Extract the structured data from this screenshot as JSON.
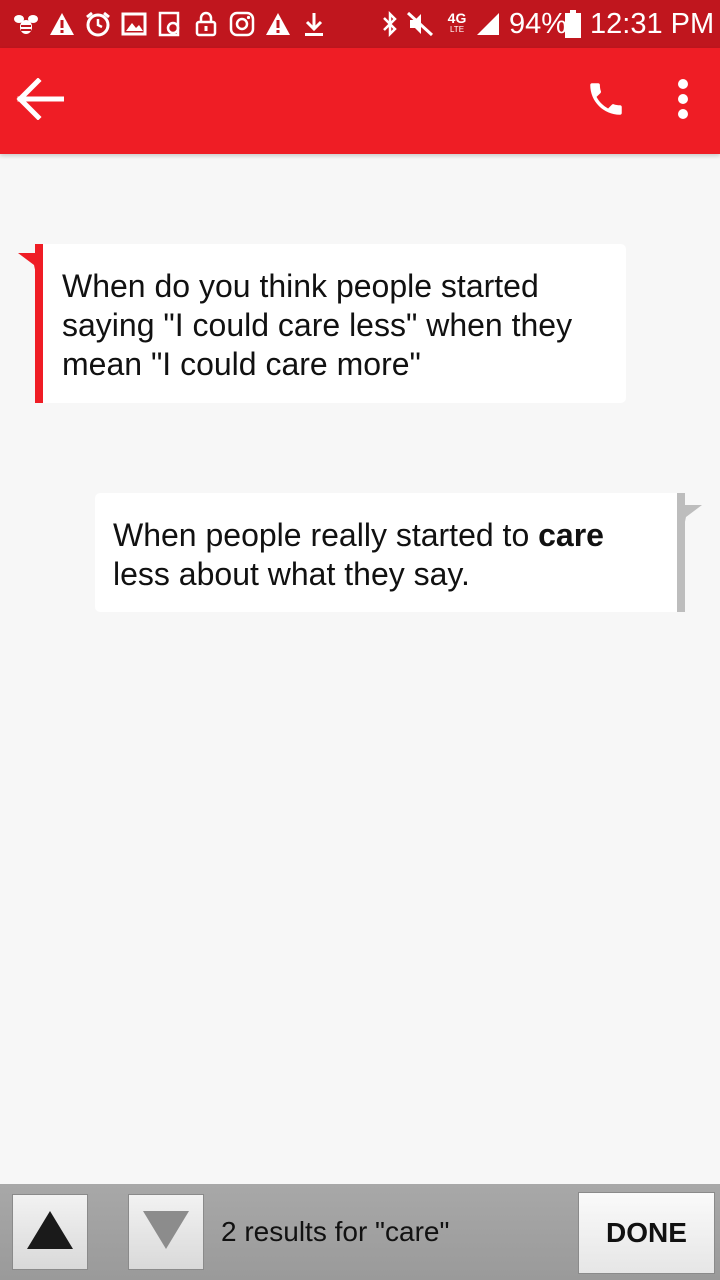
{
  "status_bar": {
    "icons_left": [
      "bee-icon",
      "warning-icon",
      "alarm-icon",
      "image-icon",
      "refresh-doc-icon",
      "lock-icon",
      "instagram-icon",
      "warning-icon",
      "download-icon"
    ],
    "icons_right": [
      "bluetooth-icon",
      "mute-icon",
      "lte-icon",
      "signal-icon",
      "battery-icon"
    ],
    "network": "4G",
    "network_sub": "LTE",
    "battery": "94%",
    "time": "12:31 PM"
  },
  "app_bar": {
    "colors": {
      "primary": "#ef1d25",
      "status": "#c0161e"
    }
  },
  "messages": [
    {
      "direction": "incoming",
      "lines": [
        "When do you think people started",
        "saying \"I could care less\" when they",
        "mean \"I could care more\""
      ]
    },
    {
      "direction": "outgoing",
      "line1_before": "When people really started to ",
      "line1_highlight": "care",
      "line2": "less about what they say."
    }
  ],
  "find_bar": {
    "results_text": "2 results for \"care\"",
    "done_label": "DONE"
  }
}
